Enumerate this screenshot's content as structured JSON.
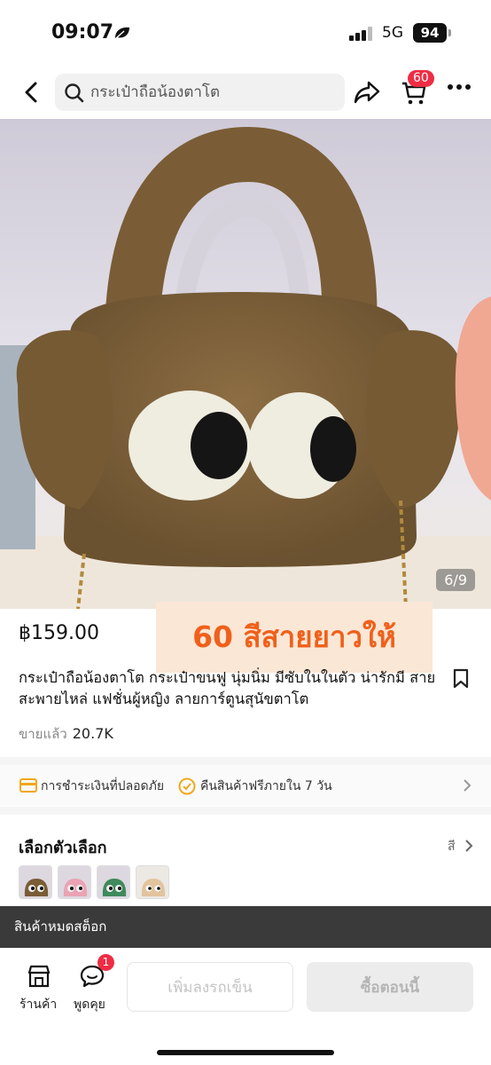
{
  "status_bar": {
    "time": "09:07",
    "network": "5G",
    "battery": "94"
  },
  "nav": {
    "search_placeholder": "กระเป๋าถือน้องตาโต",
    "cart_count": "60"
  },
  "product": {
    "image_counter": "6/9",
    "price": "฿159.00",
    "promo_text": "60 สีสายยาวให้",
    "title": "กระเป๋าถือน้องตาโต กระเป๋าขนฟู นุ่มนิ่ม มีซับในในตัว น่ารักมี สายสะพายไหล่ แฟชั่นผู้หญิง ลายการ์ตูนสุนัขตาโต",
    "sold_label": "ขายแล้ว",
    "sold_count": "20.7K"
  },
  "guarantees": {
    "payment": "การชำระเงินที่ปลอดภัย",
    "return": "คืนสินค้าฟรีภายใน 7 วัน"
  },
  "options": {
    "title": "เลือกตัวเลือก",
    "right_label": "สี",
    "swatches": [
      "brown",
      "pink",
      "green",
      "beige"
    ]
  },
  "stock_banner": "สินค้าหมดสต็อก",
  "bottom_bar": {
    "shop_label": "ร้านค้า",
    "chat_label": "พูดคุย",
    "chat_badge": "1",
    "add_to_cart": "เพิ่มลงรถเข็น",
    "buy_now": "ซื้อตอนนี้"
  },
  "colors": {
    "badge_red": "#ee2d44",
    "promo_orange": "#f0601b",
    "promo_bg": "#fbe7d6"
  }
}
